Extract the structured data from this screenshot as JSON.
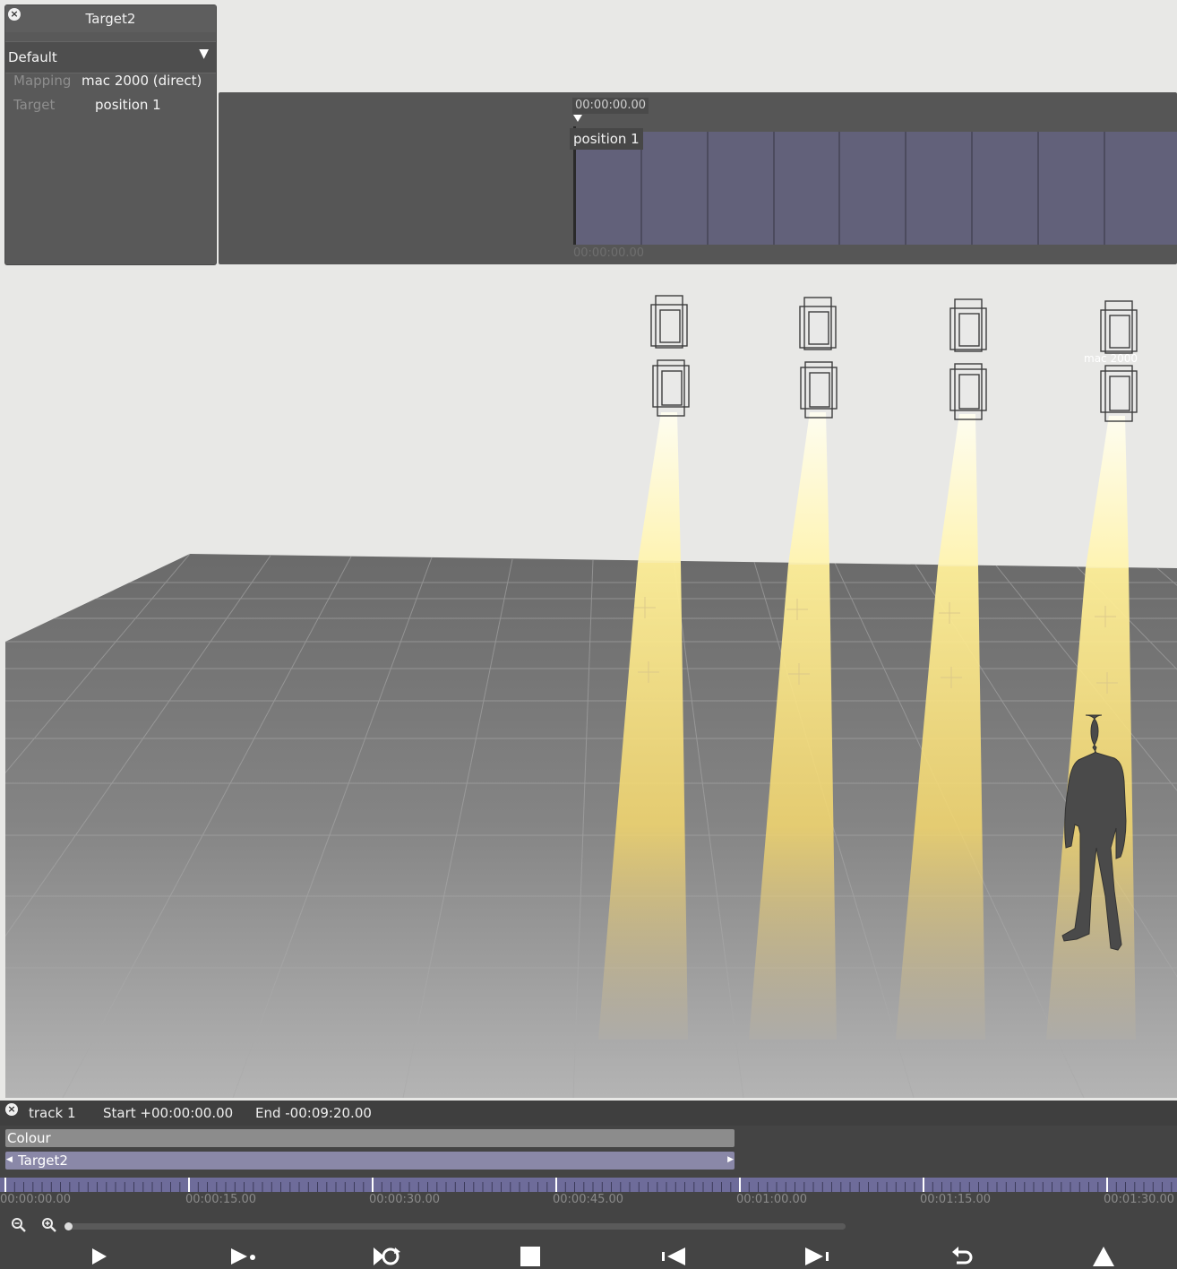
{
  "target_panel": {
    "title": "Target2",
    "preset": "Default",
    "mapping_label": "Mapping",
    "mapping_value": "mac 2000 (direct)",
    "target_label": "Target",
    "target_value": "position 1"
  },
  "timeline": {
    "time_top": "00:00:00.00",
    "clip_label": "position 1",
    "time_bottom": "00:00:00.00"
  },
  "viewport": {
    "fixture_label": "mac 2000"
  },
  "track": {
    "name": "track 1",
    "start": "Start +00:00:00.00",
    "end": "End -00:09:20.00",
    "colour_label": "Colour",
    "target_label": "Target2",
    "ruler_labels": [
      "00:00:00.00",
      "00:00:15.00",
      "00:00:30.00",
      "00:00:45.00",
      "00:01:00.00",
      "00:01:15.00",
      "00:01:30.00"
    ]
  },
  "transport": [
    "play-icon",
    "play-next-icon",
    "loop-play-icon",
    "stop-icon",
    "go-to-start-icon",
    "go-to-end-icon",
    "undo-icon",
    "eject-icon"
  ],
  "colors": {
    "panel": "#595959",
    "clip": "#62617a",
    "beam": "#fff3a8",
    "floor": "#8c8c8c"
  }
}
